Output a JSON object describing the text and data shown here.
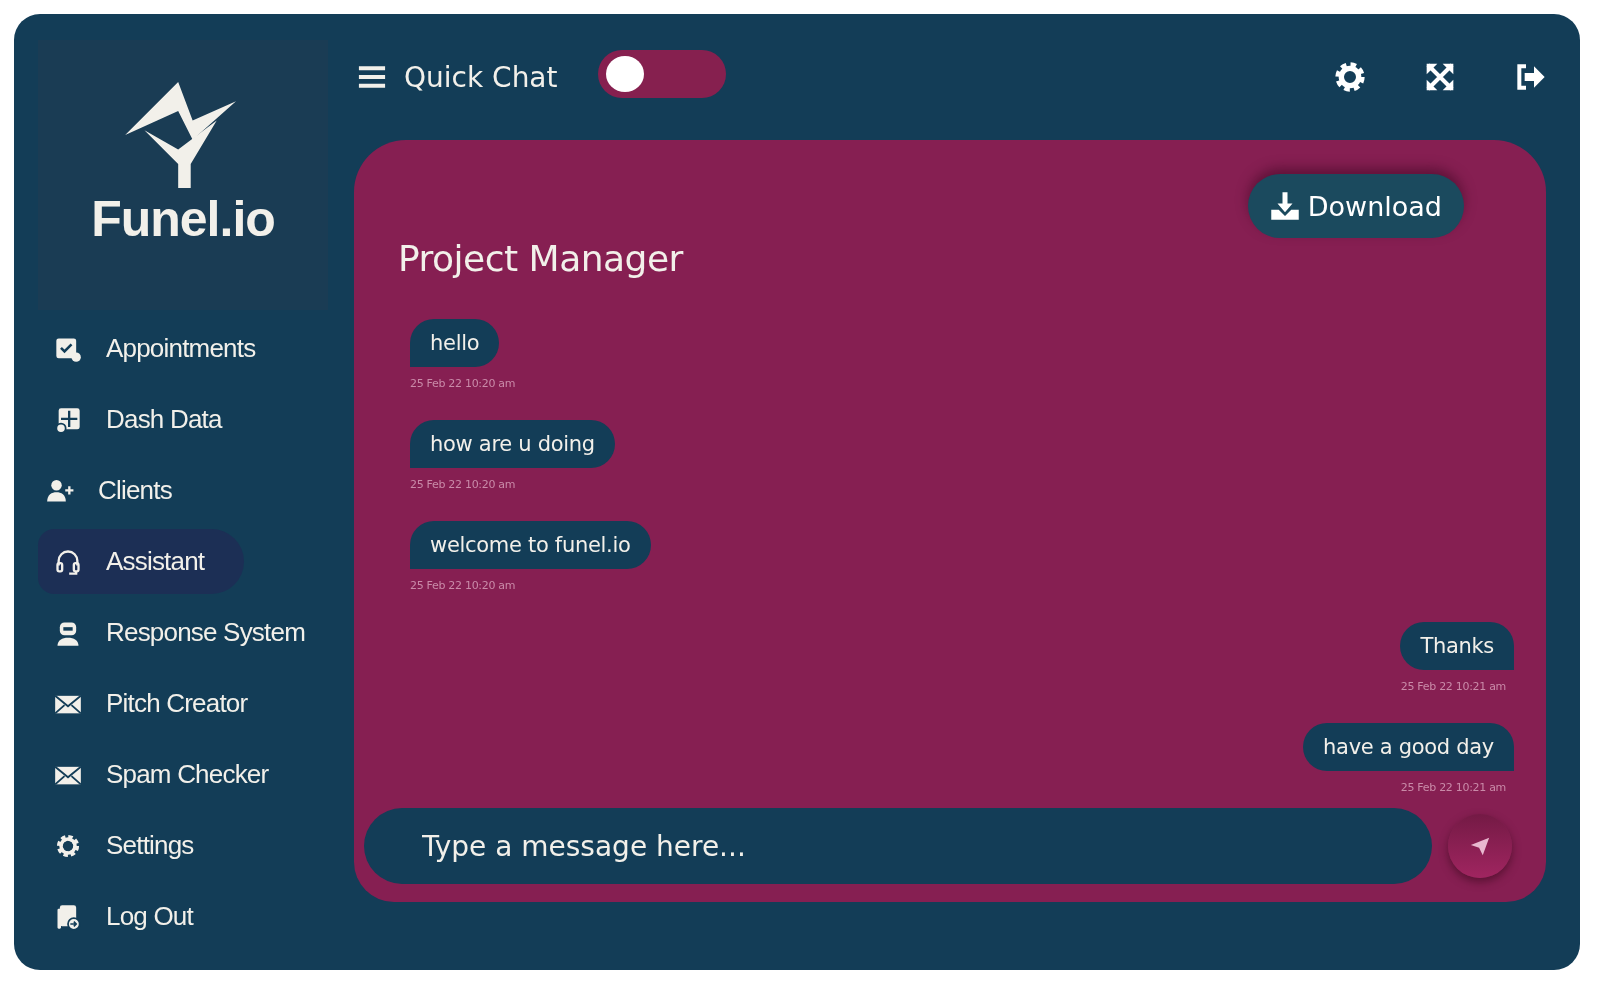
{
  "brand": "Funel.io",
  "nav": [
    {
      "label": "Appointments",
      "selected": false
    },
    {
      "label": "Dash Data",
      "selected": false
    },
    {
      "label": "Clients",
      "selected": false
    },
    {
      "label": "Assistant",
      "selected": true
    },
    {
      "label": "Response System",
      "selected": false
    },
    {
      "label": "Pitch Creator",
      "selected": false
    },
    {
      "label": "Spam Checker",
      "selected": false
    },
    {
      "label": "Settings",
      "selected": false
    },
    {
      "label": "Log Out",
      "selected": false
    }
  ],
  "quick_chat": {
    "label": "Quick Chat",
    "on": false
  },
  "chat": {
    "title": "Project Manager",
    "download": "Download",
    "messages": [
      {
        "kind": "received",
        "text": "hello",
        "time": "25 Feb 22 10:20 am"
      },
      {
        "kind": "received",
        "text": "how are u doing",
        "time": "25 Feb 22 10:20 am"
      },
      {
        "kind": "received",
        "text": "welcome to funel.io",
        "time": "25 Feb 22 10:20 am"
      },
      {
        "kind": "sent",
        "text": "Thanks",
        "time": "25 Feb 22 10:21 am"
      },
      {
        "kind": "sent",
        "text": "have a good day",
        "time": "25 Feb 22 10:21 am"
      }
    ],
    "composer": {
      "placeholder": "Type a message here..."
    }
  }
}
